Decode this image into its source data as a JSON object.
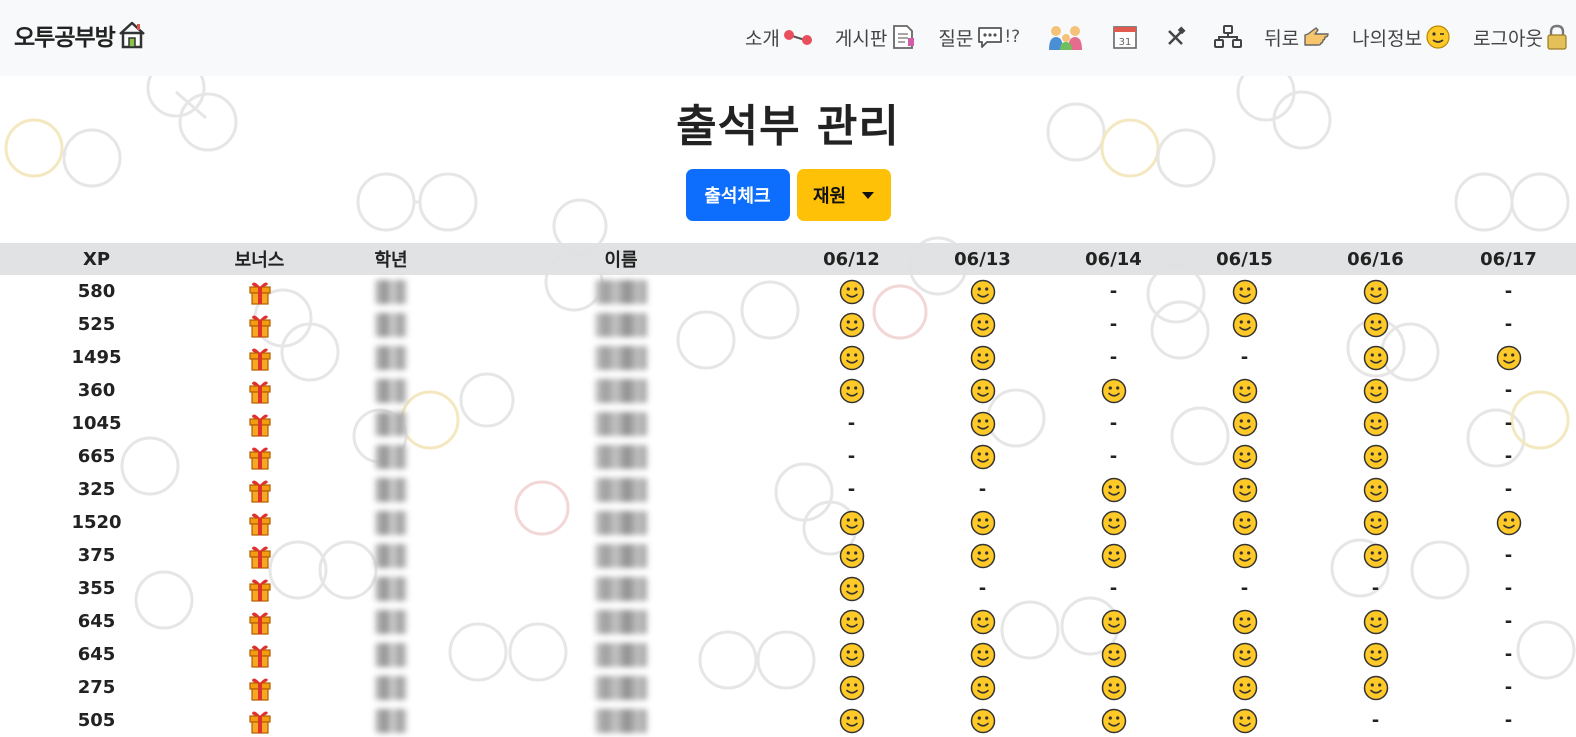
{
  "brand": {
    "name": "오투공부방",
    "icon": "house-icon"
  },
  "nav": {
    "items": [
      {
        "label": "소개",
        "icon": "molecule-icon"
      },
      {
        "label": "게시판",
        "icon": "document-icon"
      },
      {
        "label": "질문",
        "icon": "speech-bubble-icon",
        "suffix": "!?"
      },
      {
        "label": "",
        "icon": "family-icon"
      },
      {
        "label": "",
        "icon": "calendar-icon",
        "calendar_day": "31"
      },
      {
        "label": "",
        "icon": "tools-icon"
      },
      {
        "label": "",
        "icon": "network-icon"
      },
      {
        "label": "뒤로",
        "icon": "pointing-hand-icon"
      },
      {
        "label": "나의정보",
        "icon": "winking-face-icon"
      },
      {
        "label": "로그아웃",
        "icon": "lock-icon"
      }
    ]
  },
  "page": {
    "title": "출석부 관리"
  },
  "buttons": {
    "attendance_check": "출석체크",
    "select_label": "재원"
  },
  "table": {
    "headers": [
      "XP",
      "보너스",
      "학년",
      "이름",
      "06/12",
      "06/13",
      "06/14",
      "06/15",
      "06/16",
      "06/17"
    ],
    "absent_mark": "-",
    "present_icon": "smiley-icon",
    "bonus_icon": "gift-icon",
    "rows": [
      {
        "xp": "580",
        "att": [
          1,
          1,
          0,
          1,
          1,
          0
        ]
      },
      {
        "xp": "525",
        "att": [
          1,
          1,
          0,
          1,
          1,
          0
        ]
      },
      {
        "xp": "1495",
        "att": [
          1,
          1,
          0,
          0,
          1,
          1
        ]
      },
      {
        "xp": "360",
        "att": [
          1,
          1,
          1,
          1,
          1,
          0
        ]
      },
      {
        "xp": "1045",
        "att": [
          0,
          1,
          0,
          1,
          1,
          0
        ]
      },
      {
        "xp": "665",
        "att": [
          0,
          1,
          0,
          1,
          1,
          0
        ]
      },
      {
        "xp": "325",
        "att": [
          0,
          0,
          1,
          1,
          1,
          0
        ]
      },
      {
        "xp": "1520",
        "att": [
          1,
          1,
          1,
          1,
          1,
          1
        ]
      },
      {
        "xp": "375",
        "att": [
          1,
          1,
          1,
          1,
          1,
          0
        ]
      },
      {
        "xp": "355",
        "att": [
          1,
          0,
          0,
          0,
          0,
          0
        ]
      },
      {
        "xp": "645",
        "att": [
          1,
          1,
          1,
          1,
          1,
          0
        ]
      },
      {
        "xp": "645",
        "att": [
          1,
          1,
          1,
          1,
          1,
          0
        ]
      },
      {
        "xp": "275",
        "att": [
          1,
          1,
          1,
          1,
          1,
          0
        ]
      },
      {
        "xp": "505",
        "att": [
          1,
          1,
          1,
          1,
          0,
          0
        ]
      }
    ]
  },
  "colors": {
    "primary": "#0d6efd",
    "warning": "#ffc107",
    "navbar_bg": "#f8f9fa",
    "header_bg": "#dee0e2",
    "smiley": "#ffc928",
    "gift": "#f39c12"
  }
}
